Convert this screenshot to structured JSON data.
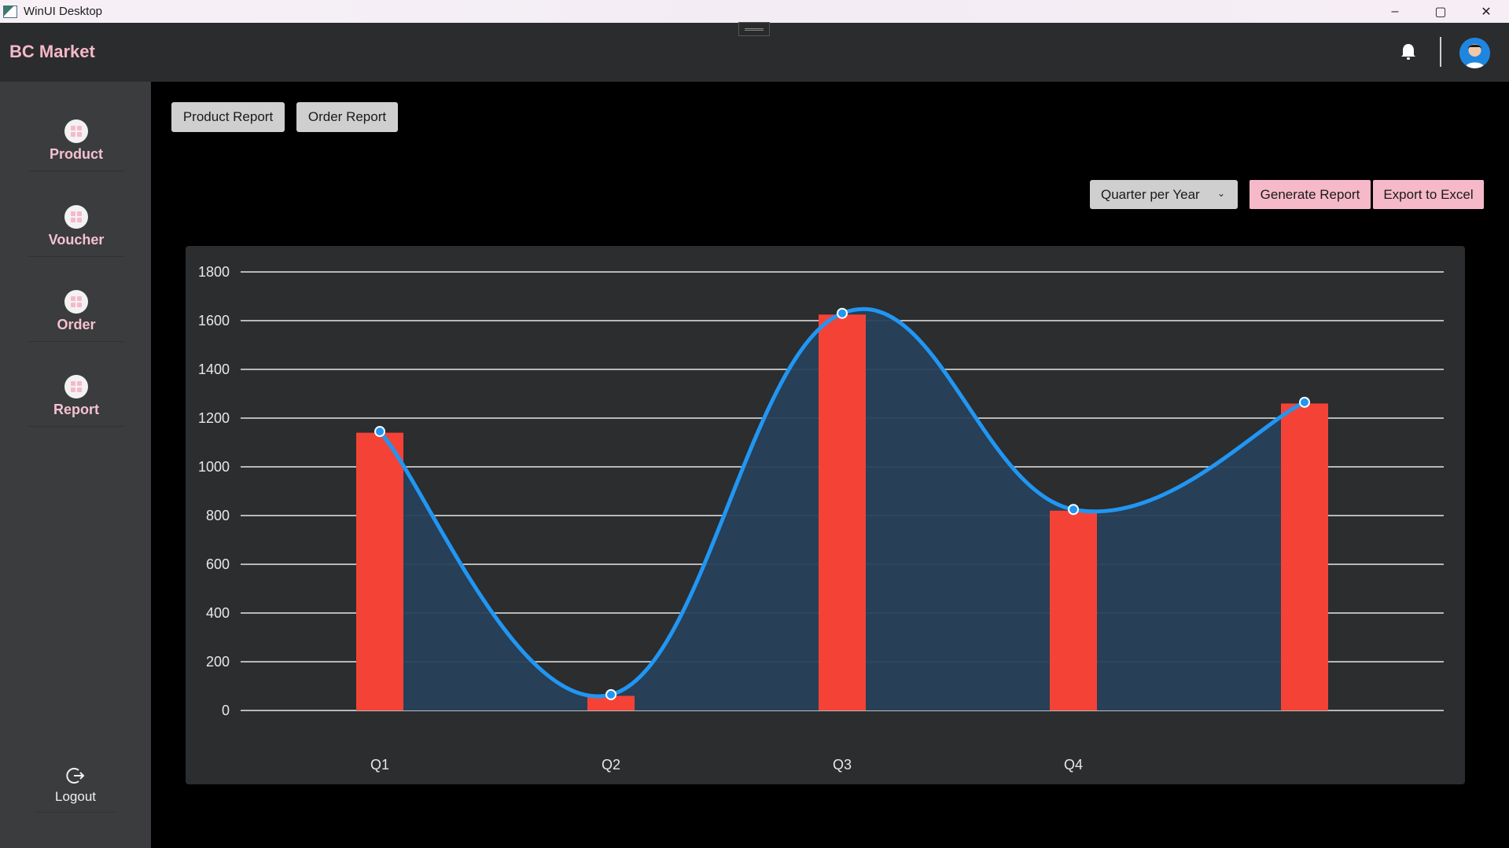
{
  "window": {
    "title": "WinUI Desktop",
    "minimize": "–",
    "maximize": "▢",
    "close": "✕"
  },
  "header": {
    "brand": "BC Market"
  },
  "sidebar": {
    "items": [
      {
        "label": "Product"
      },
      {
        "label": "Voucher"
      },
      {
        "label": "Order"
      },
      {
        "label": "Report"
      }
    ],
    "logout": "Logout"
  },
  "report_tabs": {
    "product": "Product Report",
    "order": "Order Report"
  },
  "toolbar": {
    "period_select": "Quarter per Year",
    "generate": "Generate Report",
    "export": "Export to Excel"
  },
  "colors": {
    "bar": "#f44336",
    "line": "#2196f3",
    "area": "#27405a",
    "accent": "#f6b9ca"
  },
  "chart_data": {
    "type": "bar",
    "categories": [
      "Q1",
      "Q2",
      "Q3",
      "Q4",
      ""
    ],
    "series": [
      {
        "type": "bar",
        "values": [
          1140,
          60,
          1625,
          820,
          1260
        ]
      },
      {
        "type": "area",
        "values": [
          1145,
          65,
          1630,
          825,
          1265
        ]
      }
    ],
    "y_ticks": [
      0,
      200,
      400,
      600,
      800,
      1000,
      1200,
      1400,
      1600,
      1800
    ],
    "ylim": [
      0,
      1800
    ],
    "grid": true
  }
}
